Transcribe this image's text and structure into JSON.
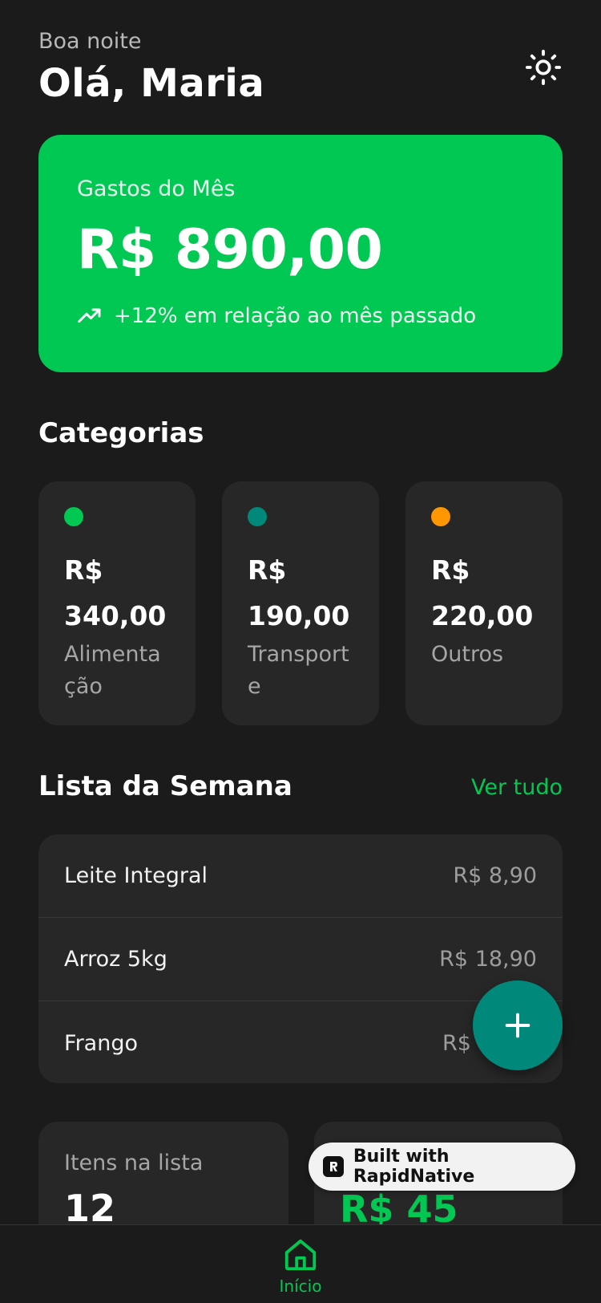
{
  "header": {
    "greeting": "Boa noite",
    "title": "Olá, Maria"
  },
  "month_card": {
    "label": "Gastos do Mês",
    "value": "R$ 890,00",
    "trend": "+12% em relação ao mês passado",
    "color": "#00c853"
  },
  "categories": {
    "title": "Categorias",
    "items": [
      {
        "value": "R$ 340,00",
        "name": "Alimentação",
        "color": "#00c853"
      },
      {
        "value": "R$ 190,00",
        "name": "Transporte",
        "color": "#00897b"
      },
      {
        "value": "R$ 220,00",
        "name": "Outros",
        "color": "#ff9800"
      }
    ]
  },
  "week_list": {
    "title": "Lista da Semana",
    "see_all": "Ver tudo",
    "items": [
      {
        "name": "Leite Integral",
        "price": "R$ 8,90"
      },
      {
        "name": "Arroz 5kg",
        "price": "R$ 18,90"
      },
      {
        "name": "Frango",
        "price": "R$"
      }
    ]
  },
  "stats": [
    {
      "label": "Itens na lista",
      "value": "12"
    },
    {
      "label": "",
      "value": "R$ 45"
    }
  ],
  "badge": {
    "text": "Built with RapidNative"
  },
  "nav": {
    "home_label": "Início"
  },
  "icons": {
    "theme": "sun-icon",
    "trend": "trending-up-icon",
    "fab": "plus-icon",
    "home": "home-icon"
  }
}
